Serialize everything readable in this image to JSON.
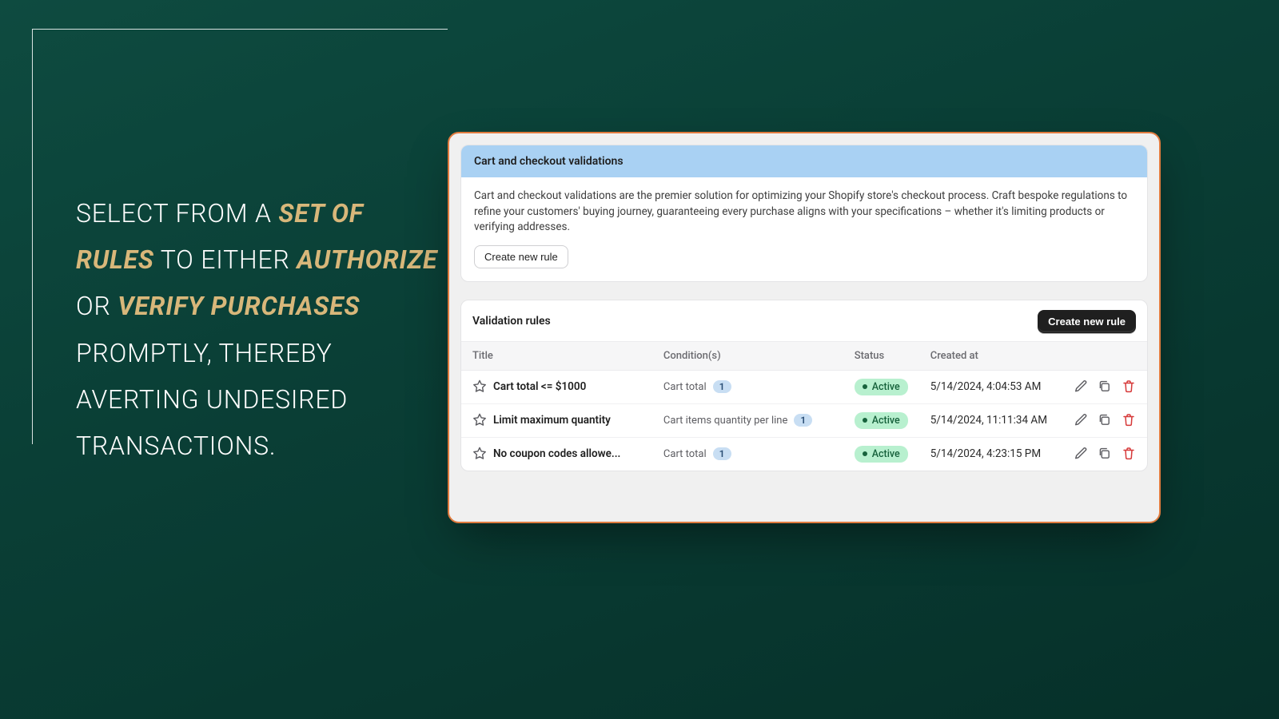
{
  "hero": {
    "part1": "SELECT FROM A ",
    "em1": "SET OF RULES",
    "part2": " TO EITHER ",
    "em2": "AUTHORIZE",
    "part3": " OR ",
    "em3": "VERIFY PURCHASES",
    "part4": " PROMPTLY, THEREBY AVERTING UNDESIRED TRANSACTIONS."
  },
  "intro": {
    "title": "Cart and checkout validations",
    "body": "Cart and checkout validations are the premier solution for optimizing your Shopify store's checkout process. Craft bespoke regulations to refine your customers' buying journey, guaranteeing every purchase aligns with your specifications – whether it's limiting products or verifying addresses.",
    "create_label": "Create new rule"
  },
  "rules": {
    "heading": "Validation rules",
    "create_label": "Create new rule",
    "columns": {
      "title": "Title",
      "conditions": "Condition(s)",
      "status": "Status",
      "created": "Created at"
    },
    "rows": [
      {
        "title": "Cart total <= $1000",
        "condition_text": "Cart total",
        "condition_count": "1",
        "status": "Active",
        "created": "5/14/2024, 4:04:53 AM"
      },
      {
        "title": "Limit maximum quantity",
        "condition_text": "Cart items quantity per line",
        "condition_count": "1",
        "status": "Active",
        "created": "5/14/2024, 11:11:34 AM"
      },
      {
        "title": "No coupon codes allowe...",
        "condition_text": "Cart total",
        "condition_count": "1",
        "status": "Active",
        "created": "5/14/2024, 4:23:15 PM"
      }
    ]
  }
}
